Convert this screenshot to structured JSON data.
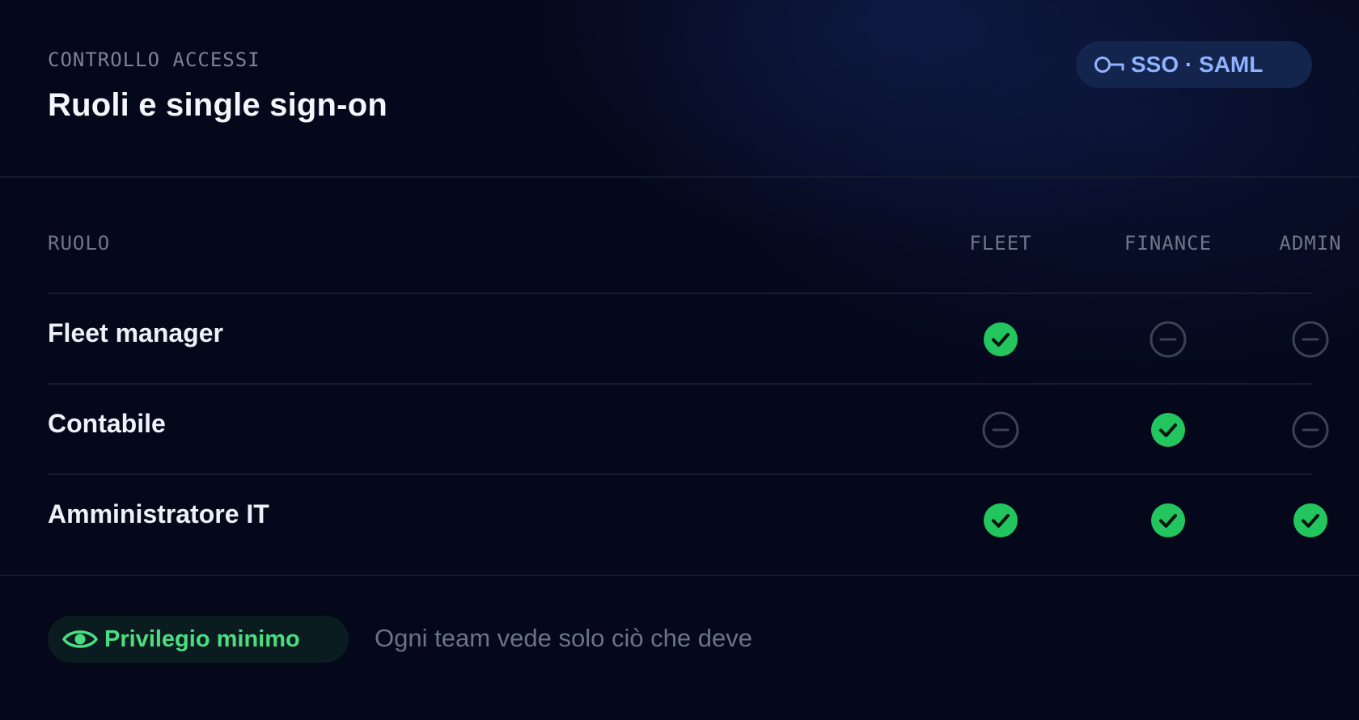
{
  "header": {
    "eyebrow": "CONTROLLO ACCESSI",
    "title": "Ruoli e single sign-on",
    "badge": {
      "icon": "key-icon",
      "label": "SSO · SAML"
    }
  },
  "table": {
    "columns": [
      "RUOLO",
      "FLEET",
      "FINANCE",
      "ADMIN"
    ],
    "rows": [
      {
        "role": "Fleet manager",
        "access": [
          "granted",
          "denied",
          "denied"
        ]
      },
      {
        "role": "Contabile",
        "access": [
          "denied",
          "granted",
          "denied"
        ]
      },
      {
        "role": "Amministratore IT",
        "access": [
          "granted",
          "granted",
          "granted"
        ]
      }
    ]
  },
  "footer": {
    "pill": {
      "icon": "eye-icon",
      "label": "Privilegio minimo"
    },
    "note": "Ogni team vede solo ciò che deve"
  },
  "colors": {
    "background": "#05081a",
    "granted": "#22c55e",
    "denied": "#3b4254",
    "badge_bg": "#13244d",
    "badge_text": "#8fb2ff",
    "pill_bg": "#0b1c20",
    "pill_text": "#4ade80"
  }
}
